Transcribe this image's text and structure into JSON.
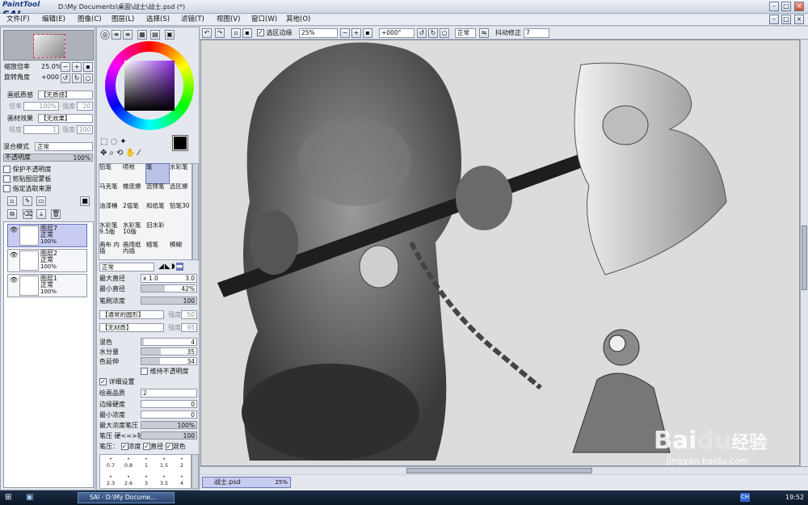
{
  "app": {
    "logo_small": "PaintTool",
    "logo_big": "SAI",
    "title": "D:\\My Documents\\桌面\\战士\\战士.psd (*)"
  },
  "menu": [
    "文件(F)",
    "编辑(E)",
    "图像(C)",
    "图层(L)",
    "选择(S)",
    "滤镜(T)",
    "视图(V)",
    "窗口(W)",
    "其他(O)"
  ],
  "navigator": {
    "zoom_label": "缩放倍率",
    "zoom_value": "25.0%",
    "rotate_label": "旋转角度",
    "rotate_value": "+000"
  },
  "texture": {
    "paper_label": "画纸质感",
    "paper_value": "【无质感】",
    "paper_scale_label": "倍率",
    "paper_scale_value": "100%",
    "paper_strength_label": "强度",
    "paper_strength_value": "20",
    "effect_label": "画材效果",
    "effect_value": "【无效果】",
    "effect_degree_label": "程度",
    "effect_degree_value": "1",
    "effect_strength_label": "强度",
    "effect_strength_value": "100"
  },
  "blend": {
    "mode_label": "混合模式",
    "mode_value": "正常",
    "opacity_label": "不透明度",
    "opacity_value": "100%",
    "opacity_fraction": 1.0
  },
  "layer_options": [
    "保护不透明度",
    "剪贴图层蒙板",
    "指定选取来源"
  ],
  "layers": [
    {
      "name": "图层7",
      "mode": "正常",
      "opacity": "100%",
      "selected": true
    },
    {
      "name": "图层2",
      "mode": "正常",
      "opacity": "100%",
      "selected": false
    },
    {
      "name": "图层1",
      "mode": "正常",
      "opacity": "100%",
      "selected": false
    }
  ],
  "tools": [
    [
      "铅笔",
      "喷枪",
      "笔",
      "水彩笔"
    ],
    [
      "马克笔",
      "橡皮擦",
      "选择笔",
      "选区擦"
    ],
    [
      "油漆桶",
      "2值笔",
      "和纸笔",
      "铅笔30"
    ],
    [
      "水彩笔 9.5版",
      "水彩笔 10版",
      "旧水彩",
      ""
    ],
    [
      "画布 内插",
      "画用纸 内插",
      "蜡笔",
      "模糊"
    ]
  ],
  "brush": {
    "mode_value": "正常",
    "max_size_label": "最大直径",
    "max_size_mult": "x 1.0",
    "max_size_value": "3.0",
    "min_size_label": "最小直径",
    "min_size_value": "42%",
    "min_size_fraction": 0.42,
    "density_label": "笔刷浓度",
    "density_value": "100",
    "density_fraction": 1.0,
    "shape_value": "【通常的圆形】",
    "shape_strength_label": "强度",
    "shape_strength_value": "50",
    "texture_value": "【无材质】",
    "texture_strength_label": "强度",
    "texture_strength_value": "95",
    "blend_label": "混色",
    "blend_value": "4",
    "blend_fraction": 0.04,
    "water_label": "水分量",
    "water_value": "35",
    "water_fraction": 0.35,
    "persist_label": "色延伸",
    "persist_value": "34",
    "persist_fraction": 0.34,
    "keep_opacity_label": "维持不透明度",
    "detail_label": "详细设置",
    "quality_label": "绘画品质",
    "quality_value": "2",
    "edge_label": "边缘硬度",
    "edge_value": "0",
    "min_density_label": "最小浓度",
    "min_density_value": "0",
    "max_pressure_label": "最大浓度笔压",
    "max_pressure_value": "100%",
    "pressure_hardness_label": "笔压 硬<=>软",
    "pressure_hardness_value": "100",
    "pressure_label": "笔压：",
    "pressure_opts": [
      "浓度",
      "直径",
      "混色"
    ]
  },
  "brush_sizes_row1": [
    "0.7",
    "0.8",
    "1",
    "1.5",
    "2"
  ],
  "brush_sizes_row2": [
    "2.3",
    "2.6",
    "3",
    "3.5",
    "4"
  ],
  "toolbar": {
    "selection_edge_label": "选区边缘",
    "zoom_value": "25%",
    "angle_value": "+000°",
    "mode_value": "正常",
    "stabilizer_label": "抖动修正",
    "stabilizer_value": "7"
  },
  "doc_tab": {
    "name": "战士.psd",
    "zoom": "25%"
  },
  "watermark": {
    "brand": "Bai",
    "brand2": "du",
    "cn": "经验",
    "url": "jingyan.baidu.com"
  },
  "taskbar": {
    "task": "SAI - D:\\My Docume...",
    "clock": "19:52",
    "lang": "CH"
  },
  "colors": {
    "accent": "#6a78b8",
    "selection": "#c8ccf2",
    "titlebar": "#cfd7e4"
  }
}
